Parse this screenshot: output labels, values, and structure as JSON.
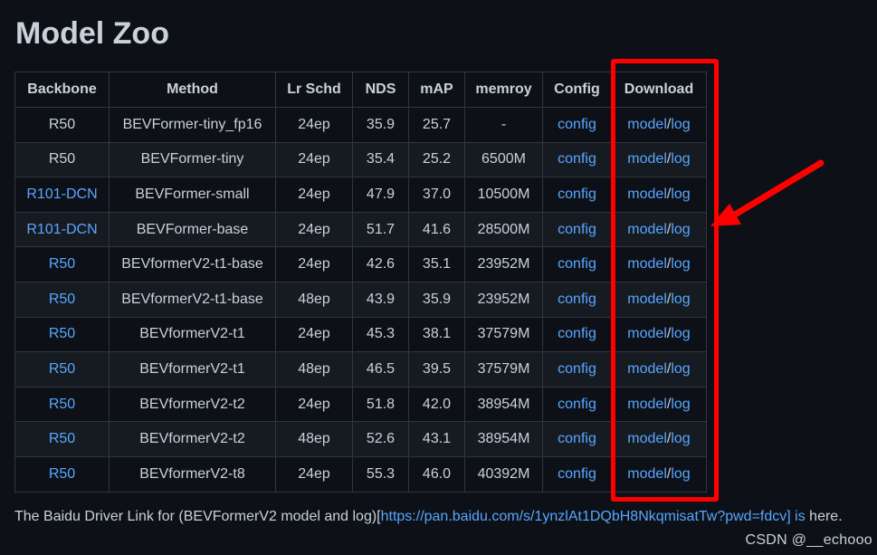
{
  "title": "Model Zoo",
  "table": {
    "headers": [
      "Backbone",
      "Method",
      "Lr Schd",
      "NDS",
      "mAP",
      "memroy",
      "Config",
      "Download"
    ],
    "rows": [
      {
        "backbone": "R50",
        "backbone_link": false,
        "method": "BEVFormer-tiny_fp16",
        "lr": "24ep",
        "nds": "35.9",
        "map": "25.7",
        "mem": "-",
        "config": "config",
        "model": "model",
        "sep": "/",
        "log": "log"
      },
      {
        "backbone": "R50",
        "backbone_link": false,
        "method": "BEVFormer-tiny",
        "lr": "24ep",
        "nds": "35.4",
        "map": "25.2",
        "mem": "6500M",
        "config": "config",
        "model": "model",
        "sep": "/",
        "log": "log"
      },
      {
        "backbone": "R101-DCN",
        "backbone_link": true,
        "method": "BEVFormer-small",
        "lr": "24ep",
        "nds": "47.9",
        "map": "37.0",
        "mem": "10500M",
        "config": "config",
        "model": "model",
        "sep": "/",
        "log": "log"
      },
      {
        "backbone": "R101-DCN",
        "backbone_link": true,
        "method": "BEVFormer-base",
        "lr": "24ep",
        "nds": "51.7",
        "map": "41.6",
        "mem": "28500M",
        "config": "config",
        "model": "model",
        "sep": "/",
        "log": "log"
      },
      {
        "backbone": "R50",
        "backbone_link": true,
        "method": "BEVformerV2-t1-base",
        "lr": "24ep",
        "nds": "42.6",
        "map": "35.1",
        "mem": "23952M",
        "config": "config",
        "model": "model",
        "sep": "/",
        "log": "log"
      },
      {
        "backbone": "R50",
        "backbone_link": true,
        "method": "BEVformerV2-t1-base",
        "lr": "48ep",
        "nds": "43.9",
        "map": "35.9",
        "mem": "23952M",
        "config": "config",
        "model": "model",
        "sep": "/",
        "log": "log"
      },
      {
        "backbone": "R50",
        "backbone_link": true,
        "method": "BEVformerV2-t1",
        "lr": "24ep",
        "nds": "45.3",
        "map": "38.1",
        "mem": "37579M",
        "config": "config",
        "model": "model",
        "sep": "/",
        "log": "log"
      },
      {
        "backbone": "R50",
        "backbone_link": true,
        "method": "BEVformerV2-t1",
        "lr": "48ep",
        "nds": "46.5",
        "map": "39.5",
        "mem": "37579M",
        "config": "config",
        "model": "model",
        "sep": "/",
        "log": "log"
      },
      {
        "backbone": "R50",
        "backbone_link": true,
        "method": "BEVformerV2-t2",
        "lr": "24ep",
        "nds": "51.8",
        "map": "42.0",
        "mem": "38954M",
        "config": "config",
        "model": "model",
        "sep": "/",
        "log": "log"
      },
      {
        "backbone": "R50",
        "backbone_link": true,
        "method": "BEVformerV2-t2",
        "lr": "48ep",
        "nds": "52.6",
        "map": "43.1",
        "mem": "38954M",
        "config": "config",
        "model": "model",
        "sep": "/",
        "log": "log"
      },
      {
        "backbone": "R50",
        "backbone_link": true,
        "method": "BEVformerV2-t8",
        "lr": "24ep",
        "nds": "55.3",
        "map": "46.0",
        "mem": "40392M",
        "config": "config",
        "model": "model",
        "sep": "/",
        "log": "log"
      }
    ]
  },
  "footnote": {
    "prefix": "The Baidu Driver Link for (BEVFormerV2 model and log)[",
    "link": "https://pan.baidu.com/s/1ynzlAt1DQbH8NkqmisatTw?pwd=fdcv] is",
    "suffix": " here."
  },
  "watermark": "CSDN @__echooo",
  "colors": {
    "background": "#0d1117",
    "text": "#c9d1d9",
    "link": "#58a6ff",
    "annotation": "#ff0000"
  }
}
